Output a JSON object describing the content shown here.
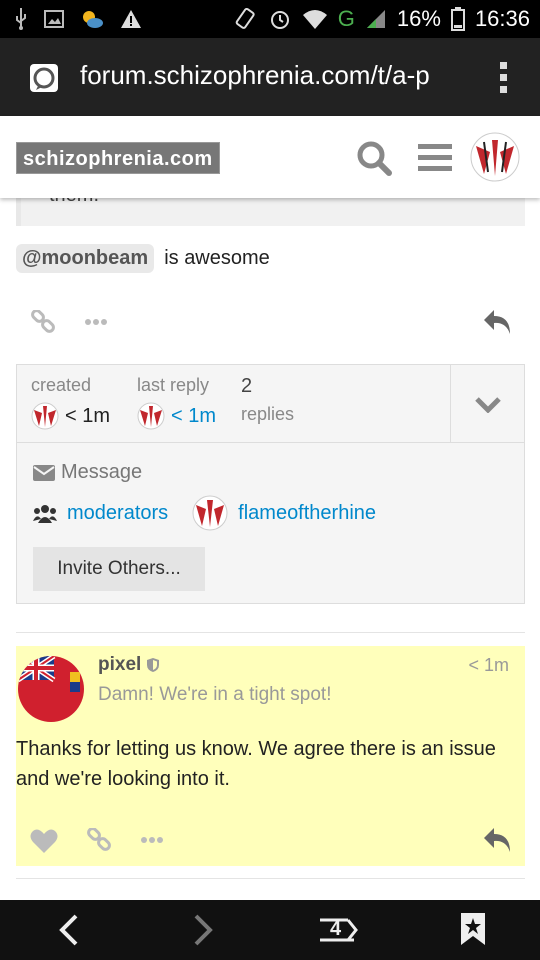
{
  "status_bar": {
    "battery_percent": "16%",
    "time": "16:36",
    "network_label": "G"
  },
  "browser": {
    "url": "forum.schizophrenia.com/t/a-p"
  },
  "site": {
    "logo_text": "schizophrenia.com"
  },
  "post1": {
    "quote_tail": "them.",
    "mention": "@moonbeam",
    "text": "is awesome"
  },
  "topic_map": {
    "created_label": "created",
    "created_value": "< 1m",
    "last_reply_label": "last reply",
    "last_reply_value": "< 1m",
    "replies_count": "2",
    "replies_label": "replies",
    "message_label": "Message",
    "group_name": "moderators",
    "participant_name": "flameoftherhine",
    "invite_label": "Invite Others..."
  },
  "post2": {
    "username": "pixel",
    "user_title": "Damn! We're in a tight spot!",
    "time": "< 1m",
    "body": "Thanks for letting us know. We agree there is an issue and we're looking into it."
  },
  "bottom_nav": {
    "tab_count": "4"
  },
  "colors": {
    "link": "#0088cc",
    "highlight_post": "#ffffbb",
    "header_bg": "#222222"
  }
}
